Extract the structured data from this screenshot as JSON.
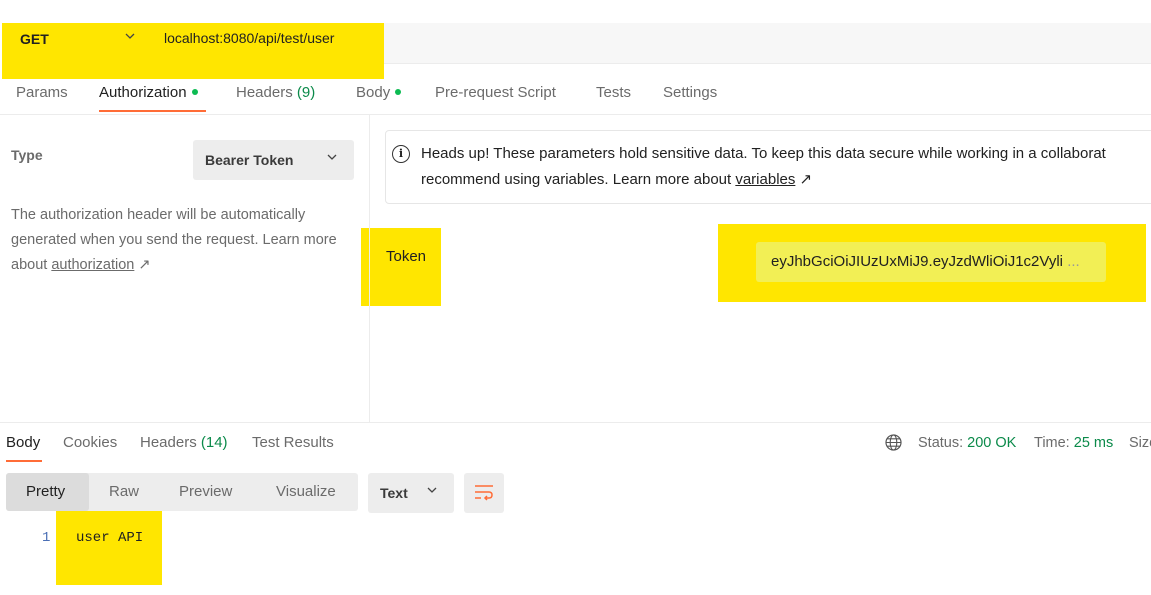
{
  "request": {
    "method": "GET",
    "url": "localhost:8080/api/test/user"
  },
  "request_tabs": {
    "params": "Params",
    "authorization": "Authorization",
    "headers": "Headers",
    "headers_count": "(9)",
    "body": "Body",
    "prerequest": "Pre-request Script",
    "tests": "Tests",
    "settings": "Settings"
  },
  "auth": {
    "type_label": "Type",
    "type_value": "Bearer Token",
    "desc_text": "The authorization header will be automatically generated when you send the request. Learn more about ",
    "desc_link": "authorization",
    "info_line1": "Heads up! These parameters hold sensitive data. To keep this data secure while working in a collaborat",
    "info_line2": "recommend using variables. Learn more about ",
    "info_link": "variables",
    "token_label": "Token",
    "token_value": "eyJhbGciOiJIUzUxMiJ9.eyJzdWliOiJ1c2Vyli",
    "token_ellipsis": "..."
  },
  "response_tabs": {
    "body": "Body",
    "cookies": "Cookies",
    "headers": "Headers",
    "headers_count": "(14)",
    "test_results": "Test Results"
  },
  "status": {
    "status_label": "Status:",
    "status_value": "200 OK",
    "time_label": "Time:",
    "time_value": "25 ms",
    "size_label": "Size"
  },
  "view_modes": {
    "pretty": "Pretty",
    "raw": "Raw",
    "preview": "Preview",
    "visualize": "Visualize"
  },
  "format": "Text",
  "response_body": {
    "line_number": "1",
    "content": "user API"
  },
  "colors": {
    "highlight": "#ffe600",
    "accent": "#ff6c37",
    "success": "#0b8a4a"
  }
}
